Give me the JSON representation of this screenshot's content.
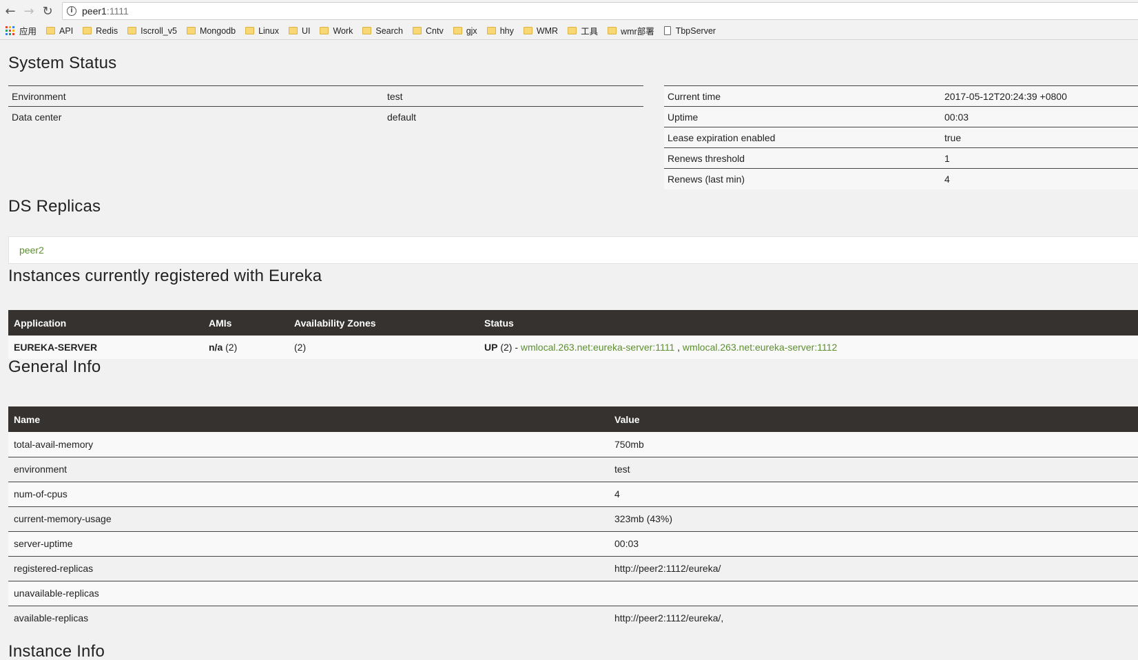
{
  "browser": {
    "url_host": "peer1",
    "url_port": ":1111",
    "bookmarks": [
      {
        "label": "应用",
        "type": "apps"
      },
      {
        "label": "API",
        "type": "folder"
      },
      {
        "label": "Redis",
        "type": "folder"
      },
      {
        "label": "Iscroll_v5",
        "type": "folder"
      },
      {
        "label": "Mongodb",
        "type": "folder"
      },
      {
        "label": "Linux",
        "type": "folder"
      },
      {
        "label": "UI",
        "type": "folder"
      },
      {
        "label": "Work",
        "type": "folder"
      },
      {
        "label": "Search",
        "type": "folder"
      },
      {
        "label": "Cntv",
        "type": "folder"
      },
      {
        "label": "gjx",
        "type": "folder"
      },
      {
        "label": "hhy",
        "type": "folder"
      },
      {
        "label": "WMR",
        "type": "folder"
      },
      {
        "label": "工具",
        "type": "folder"
      },
      {
        "label": "wmr部署",
        "type": "folder"
      },
      {
        "label": "TbpServer",
        "type": "page"
      }
    ]
  },
  "system_status": {
    "title": "System Status",
    "left": [
      {
        "key": "Environment",
        "value": "test"
      },
      {
        "key": "Data center",
        "value": "default"
      }
    ],
    "right": [
      {
        "key": "Current time",
        "value": "2017-05-12T20:24:39 +0800"
      },
      {
        "key": "Uptime",
        "value": "00:03"
      },
      {
        "key": "Lease expiration enabled",
        "value": "true"
      },
      {
        "key": "Renews threshold",
        "value": "1"
      },
      {
        "key": "Renews (last min)",
        "value": "4"
      }
    ]
  },
  "ds_replicas": {
    "title": "DS Replicas",
    "items": [
      "peer2"
    ]
  },
  "instances": {
    "title": "Instances currently registered with Eureka",
    "headers": [
      "Application",
      "AMIs",
      "Availability Zones",
      "Status"
    ],
    "rows": [
      {
        "application": "EUREKA-SERVER",
        "amis_bold": "n/a",
        "amis_count": " (2)",
        "zones": "(2)",
        "status_bold": "UP",
        "status_count": " (2) - ",
        "link1": "wmlocal.263.net:eureka-server:1111",
        "sep": " , ",
        "link2": "wmlocal.263.net:eureka-server:1112"
      }
    ]
  },
  "general_info": {
    "title": "General Info",
    "headers": [
      "Name",
      "Value"
    ],
    "rows": [
      {
        "name": "total-avail-memory",
        "value": "750mb"
      },
      {
        "name": "environment",
        "value": "test"
      },
      {
        "name": "num-of-cpus",
        "value": "4"
      },
      {
        "name": "current-memory-usage",
        "value": "323mb (43%)"
      },
      {
        "name": "server-uptime",
        "value": "00:03"
      },
      {
        "name": "registered-replicas",
        "value": "http://peer2:1112/eureka/"
      },
      {
        "name": "unavailable-replicas",
        "value": ""
      },
      {
        "name": "available-replicas",
        "value": "http://peer2:1112/eureka/,"
      }
    ]
  },
  "instance_info": {
    "title": "Instance Info"
  }
}
